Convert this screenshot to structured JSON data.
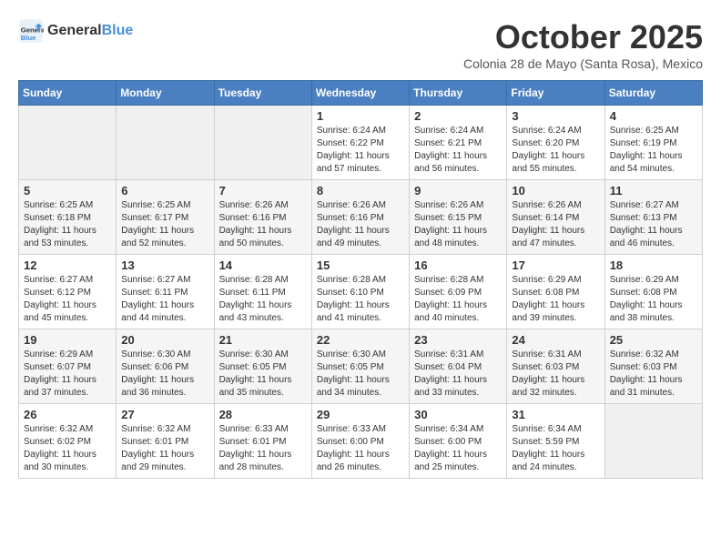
{
  "header": {
    "logo_line1": "General",
    "logo_line2": "Blue",
    "month_title": "October 2025",
    "subtitle": "Colonia 28 de Mayo (Santa Rosa), Mexico"
  },
  "weekdays": [
    "Sunday",
    "Monday",
    "Tuesday",
    "Wednesday",
    "Thursday",
    "Friday",
    "Saturday"
  ],
  "weeks": [
    [
      {
        "day": "",
        "info": ""
      },
      {
        "day": "",
        "info": ""
      },
      {
        "day": "",
        "info": ""
      },
      {
        "day": "1",
        "info": "Sunrise: 6:24 AM\nSunset: 6:22 PM\nDaylight: 11 hours\nand 57 minutes."
      },
      {
        "day": "2",
        "info": "Sunrise: 6:24 AM\nSunset: 6:21 PM\nDaylight: 11 hours\nand 56 minutes."
      },
      {
        "day": "3",
        "info": "Sunrise: 6:24 AM\nSunset: 6:20 PM\nDaylight: 11 hours\nand 55 minutes."
      },
      {
        "day": "4",
        "info": "Sunrise: 6:25 AM\nSunset: 6:19 PM\nDaylight: 11 hours\nand 54 minutes."
      }
    ],
    [
      {
        "day": "5",
        "info": "Sunrise: 6:25 AM\nSunset: 6:18 PM\nDaylight: 11 hours\nand 53 minutes."
      },
      {
        "day": "6",
        "info": "Sunrise: 6:25 AM\nSunset: 6:17 PM\nDaylight: 11 hours\nand 52 minutes."
      },
      {
        "day": "7",
        "info": "Sunrise: 6:26 AM\nSunset: 6:16 PM\nDaylight: 11 hours\nand 50 minutes."
      },
      {
        "day": "8",
        "info": "Sunrise: 6:26 AM\nSunset: 6:16 PM\nDaylight: 11 hours\nand 49 minutes."
      },
      {
        "day": "9",
        "info": "Sunrise: 6:26 AM\nSunset: 6:15 PM\nDaylight: 11 hours\nand 48 minutes."
      },
      {
        "day": "10",
        "info": "Sunrise: 6:26 AM\nSunset: 6:14 PM\nDaylight: 11 hours\nand 47 minutes."
      },
      {
        "day": "11",
        "info": "Sunrise: 6:27 AM\nSunset: 6:13 PM\nDaylight: 11 hours\nand 46 minutes."
      }
    ],
    [
      {
        "day": "12",
        "info": "Sunrise: 6:27 AM\nSunset: 6:12 PM\nDaylight: 11 hours\nand 45 minutes."
      },
      {
        "day": "13",
        "info": "Sunrise: 6:27 AM\nSunset: 6:11 PM\nDaylight: 11 hours\nand 44 minutes."
      },
      {
        "day": "14",
        "info": "Sunrise: 6:28 AM\nSunset: 6:11 PM\nDaylight: 11 hours\nand 43 minutes."
      },
      {
        "day": "15",
        "info": "Sunrise: 6:28 AM\nSunset: 6:10 PM\nDaylight: 11 hours\nand 41 minutes."
      },
      {
        "day": "16",
        "info": "Sunrise: 6:28 AM\nSunset: 6:09 PM\nDaylight: 11 hours\nand 40 minutes."
      },
      {
        "day": "17",
        "info": "Sunrise: 6:29 AM\nSunset: 6:08 PM\nDaylight: 11 hours\nand 39 minutes."
      },
      {
        "day": "18",
        "info": "Sunrise: 6:29 AM\nSunset: 6:08 PM\nDaylight: 11 hours\nand 38 minutes."
      }
    ],
    [
      {
        "day": "19",
        "info": "Sunrise: 6:29 AM\nSunset: 6:07 PM\nDaylight: 11 hours\nand 37 minutes."
      },
      {
        "day": "20",
        "info": "Sunrise: 6:30 AM\nSunset: 6:06 PM\nDaylight: 11 hours\nand 36 minutes."
      },
      {
        "day": "21",
        "info": "Sunrise: 6:30 AM\nSunset: 6:05 PM\nDaylight: 11 hours\nand 35 minutes."
      },
      {
        "day": "22",
        "info": "Sunrise: 6:30 AM\nSunset: 6:05 PM\nDaylight: 11 hours\nand 34 minutes."
      },
      {
        "day": "23",
        "info": "Sunrise: 6:31 AM\nSunset: 6:04 PM\nDaylight: 11 hours\nand 33 minutes."
      },
      {
        "day": "24",
        "info": "Sunrise: 6:31 AM\nSunset: 6:03 PM\nDaylight: 11 hours\nand 32 minutes."
      },
      {
        "day": "25",
        "info": "Sunrise: 6:32 AM\nSunset: 6:03 PM\nDaylight: 11 hours\nand 31 minutes."
      }
    ],
    [
      {
        "day": "26",
        "info": "Sunrise: 6:32 AM\nSunset: 6:02 PM\nDaylight: 11 hours\nand 30 minutes."
      },
      {
        "day": "27",
        "info": "Sunrise: 6:32 AM\nSunset: 6:01 PM\nDaylight: 11 hours\nand 29 minutes."
      },
      {
        "day": "28",
        "info": "Sunrise: 6:33 AM\nSunset: 6:01 PM\nDaylight: 11 hours\nand 28 minutes."
      },
      {
        "day": "29",
        "info": "Sunrise: 6:33 AM\nSunset: 6:00 PM\nDaylight: 11 hours\nand 26 minutes."
      },
      {
        "day": "30",
        "info": "Sunrise: 6:34 AM\nSunset: 6:00 PM\nDaylight: 11 hours\nand 25 minutes."
      },
      {
        "day": "31",
        "info": "Sunrise: 6:34 AM\nSunset: 5:59 PM\nDaylight: 11 hours\nand 24 minutes."
      },
      {
        "day": "",
        "info": ""
      }
    ]
  ]
}
